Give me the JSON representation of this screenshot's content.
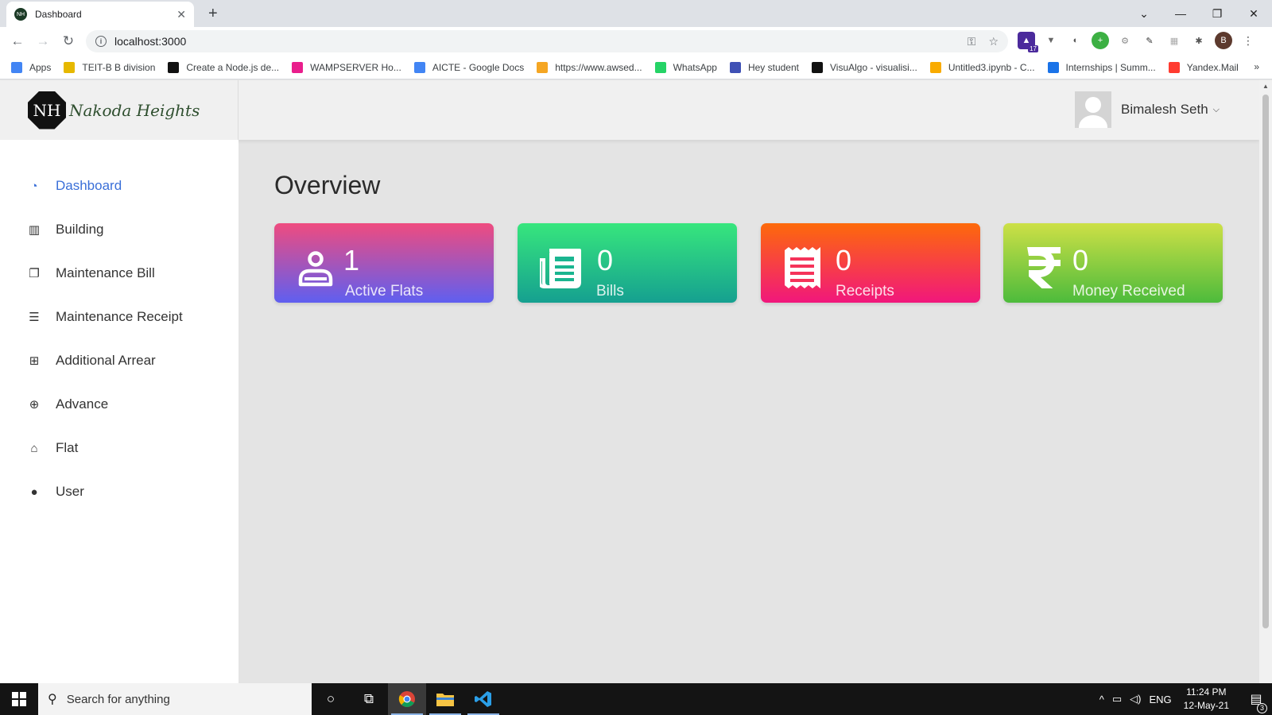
{
  "browser": {
    "tab_title": "Dashboard",
    "tab_favicon": "NH",
    "url": "localhost:3000",
    "profile_initial": "B",
    "extension_badge": "17",
    "bookmarks": [
      {
        "label": "Apps",
        "color": "#4285f4"
      },
      {
        "label": "TEIT-B B division",
        "color": "#e6b800"
      },
      {
        "label": "Create a Node.js de...",
        "color": "#111111"
      },
      {
        "label": "WAMPSERVER Ho...",
        "color": "#e91e8c"
      },
      {
        "label": "AICTE - Google Docs",
        "color": "#4285f4"
      },
      {
        "label": "https://www.awsed...",
        "color": "#f5a623"
      },
      {
        "label": "WhatsApp",
        "color": "#25d366"
      },
      {
        "label": "Hey student",
        "color": "#3f51b5"
      },
      {
        "label": "VisuAlgo - visualisi...",
        "color": "#111111"
      },
      {
        "label": "Untitled3.ipynb - C...",
        "color": "#f9ab00"
      },
      {
        "label": "Internships | Summ...",
        "color": "#1a73e8"
      },
      {
        "label": "Yandex.Mail",
        "color": "#ff3b30"
      }
    ],
    "bookmarks_more": "»"
  },
  "app": {
    "brand_logo_text": "NH",
    "brand_name": "Nakoda Heights",
    "user_name": "Bimalesh Seth",
    "sidebar": [
      {
        "label": "Dashboard",
        "icon": "dashboard-icon",
        "active": true
      },
      {
        "label": "Building",
        "icon": "building-icon",
        "active": false
      },
      {
        "label": "Maintenance Bill",
        "icon": "bill-icon",
        "active": false
      },
      {
        "label": "Maintenance Receipt",
        "icon": "receipt-icon",
        "active": false
      },
      {
        "label": "Additional Arrear",
        "icon": "plus-square-icon",
        "active": false
      },
      {
        "label": "Advance",
        "icon": "plus-circle-icon",
        "active": false
      },
      {
        "label": "Flat",
        "icon": "home-icon",
        "active": false
      },
      {
        "label": "User",
        "icon": "user-icon",
        "active": false
      }
    ],
    "main_title": "Overview",
    "cards": [
      {
        "value": "1",
        "label": "Active Flats",
        "icon": "user-outline-icon"
      },
      {
        "value": "0",
        "label": "Bills",
        "icon": "newspaper-icon"
      },
      {
        "value": "0",
        "label": "Receipts",
        "icon": "receipt-icon"
      },
      {
        "value": "0",
        "label": "Money Received",
        "icon": "rupee-icon"
      }
    ],
    "accent_color": "#3a6fd8"
  },
  "taskbar": {
    "search_placeholder": "Search for anything",
    "language": "ENG",
    "time": "11:24 PM",
    "date": "12-May-21",
    "notification_count": "3"
  }
}
